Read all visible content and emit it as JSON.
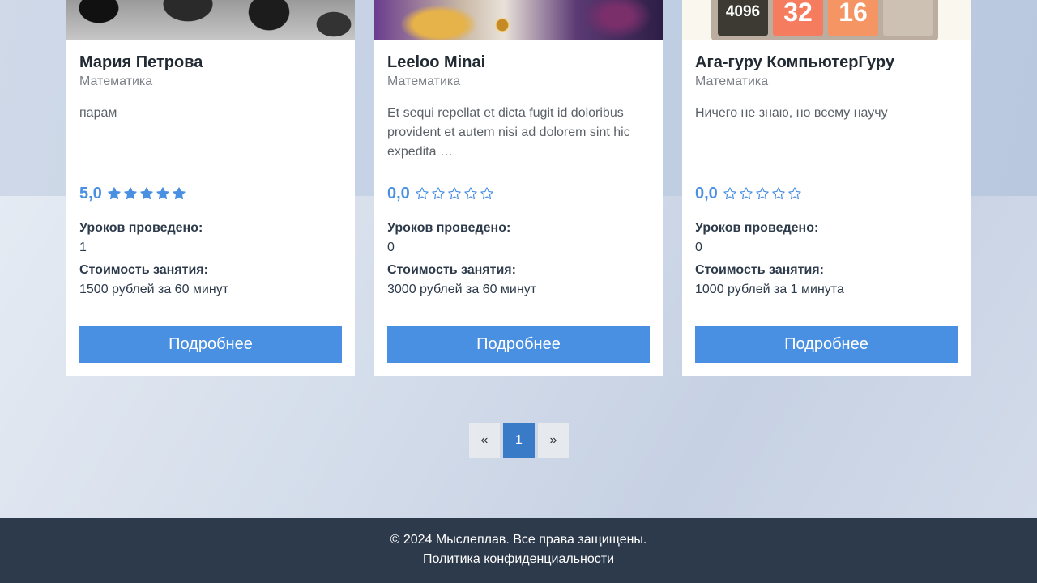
{
  "cards": [
    {
      "name": "Мария Петрова",
      "subject": "Математика",
      "description": "парам",
      "rating": "5,0",
      "rating_stars": 5,
      "lessons_label": "Уроков проведено:",
      "lessons_value": "1",
      "price_label": "Стоимость занятия:",
      "price_value": "1500 рублей за 60 минут",
      "button_label": "Подробнее"
    },
    {
      "name": "Leeloo Minai",
      "subject": "Математика",
      "description": "Et sequi repellat et dicta fugit id doloribus provident et autem nisi ad dolorem sint hic expedita …",
      "rating": "0,0",
      "rating_stars": 0,
      "lessons_label": "Уроков проведено:",
      "lessons_value": "0",
      "price_label": "Стоимость занятия:",
      "price_value": "3000 рублей за 60 минут",
      "button_label": "Подробнее"
    },
    {
      "name": "Ага-гуру КомпьютерГуру",
      "subject": "Математика",
      "description": "Ничего не знаю, но всему научу",
      "rating": "0,0",
      "rating_stars": 0,
      "lessons_label": "Уроков проведено:",
      "lessons_value": "0",
      "price_label": "Стоимость занятия:",
      "price_value": "1000 рублей за 1 минута",
      "button_label": "Подробнее",
      "photo_tiles": [
        "4096",
        "32",
        "16",
        ""
      ]
    }
  ],
  "pagination": {
    "prev": "«",
    "current": "1",
    "next": "»"
  },
  "footer": {
    "copyright": "© 2024 Мыслеплав. Все права защищены.",
    "privacy_link": "Политика конфиденциальности"
  },
  "colors": {
    "accent": "#4a90e2",
    "footer_bg": "#2d3a4c",
    "active_page": "#3a7bc8"
  }
}
